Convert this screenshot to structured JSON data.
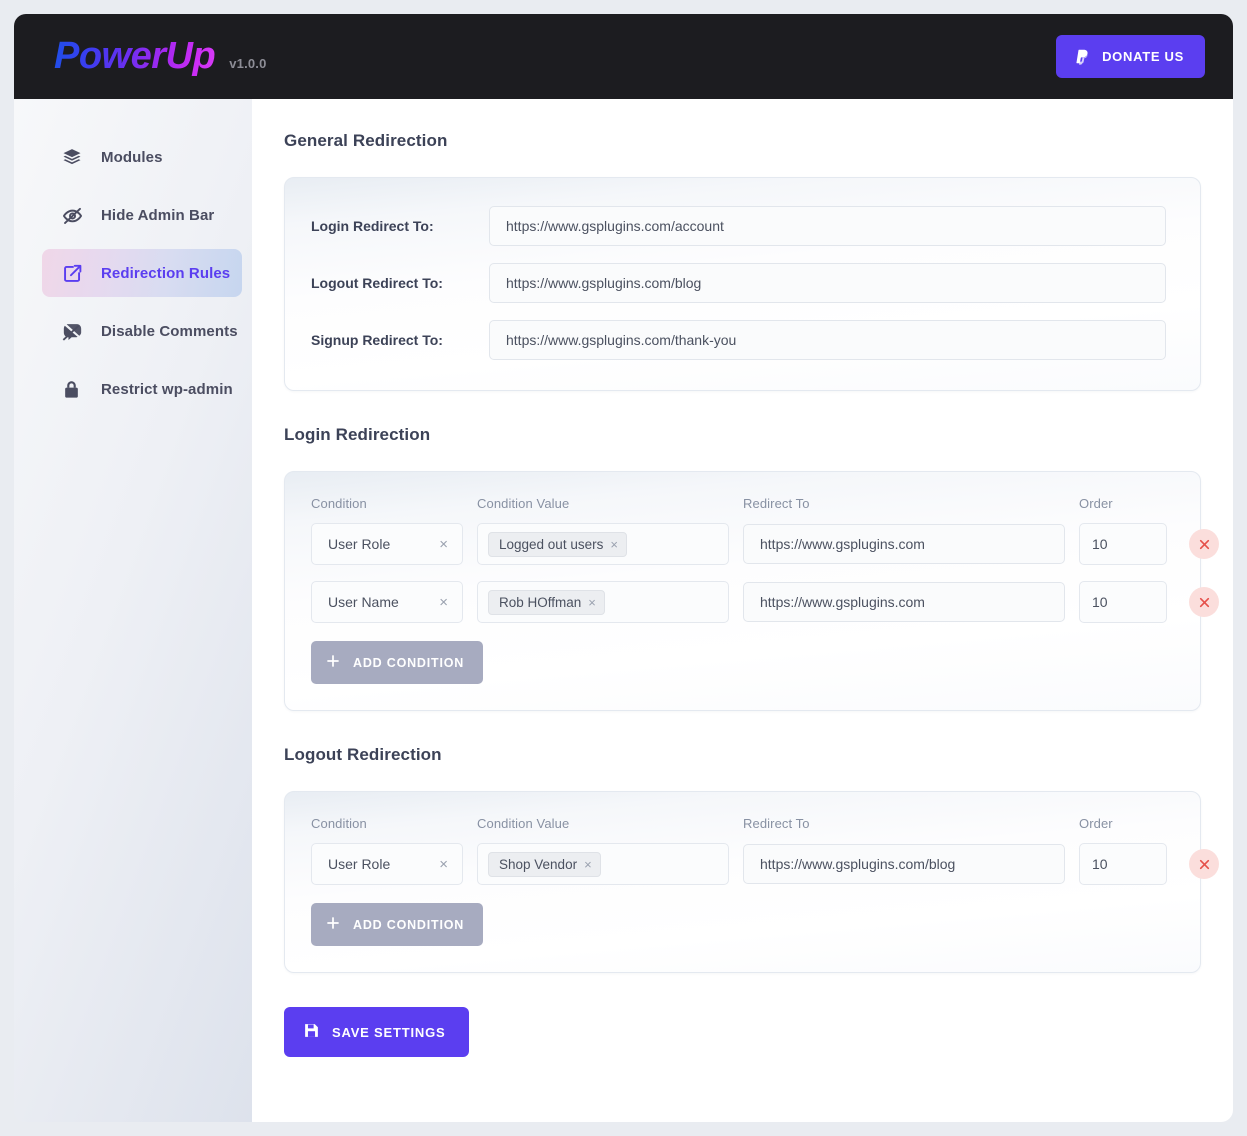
{
  "header": {
    "brand": "PowerUp",
    "version": "v1.0.0",
    "donate_label": "DONATE US",
    "donate_icon": "paypal-icon",
    "bg_color": "#1c1c20",
    "accent_color": "#5b3ef0"
  },
  "sidebar": {
    "items": [
      {
        "label": "Modules",
        "icon": "layers-icon",
        "active": false
      },
      {
        "label": "Hide Admin Bar",
        "icon": "eye-off-icon",
        "active": false
      },
      {
        "label": "Redirection Rules",
        "icon": "external-link-icon",
        "active": true
      },
      {
        "label": "Disable Comments",
        "icon": "comment-off-icon",
        "active": false
      },
      {
        "label": "Restrict wp-admin",
        "icon": "lock-icon",
        "active": false
      }
    ]
  },
  "general_redirection": {
    "title": "General Redirection",
    "fields": [
      {
        "label": "Login Redirect To:",
        "value": "https://www.gsplugins.com/account"
      },
      {
        "label": "Logout Redirect To:",
        "value": "https://www.gsplugins.com/blog"
      },
      {
        "label": "Signup Redirect To:",
        "value": "https://www.gsplugins.com/thank-you"
      }
    ]
  },
  "columns": {
    "condition": "Condition",
    "condition_value": "Condition Value",
    "redirect_to": "Redirect To",
    "order": "Order"
  },
  "login_redirection": {
    "title": "Login Redirection",
    "add_label": "ADD CONDITION",
    "rows": [
      {
        "condition": "User Role",
        "chip": "Logged out users",
        "redirect": "https://www.gsplugins.com",
        "order": "10"
      },
      {
        "condition": "User Name",
        "chip": "Rob HOffman",
        "redirect": "https://www.gsplugins.com",
        "order": "10"
      }
    ]
  },
  "logout_redirection": {
    "title": "Logout Redirection",
    "add_label": "ADD CONDITION",
    "rows": [
      {
        "condition": "User Role",
        "chip": "Shop Vendor",
        "redirect": "https://www.gsplugins.com/blog",
        "order": "10"
      }
    ]
  },
  "footer": {
    "save_label": "SAVE SETTINGS",
    "save_icon": "floppy-disk-icon"
  },
  "icons": {
    "clear": "×",
    "chip_remove": "×",
    "delete_row": "close-icon",
    "add": "plus-icon"
  }
}
